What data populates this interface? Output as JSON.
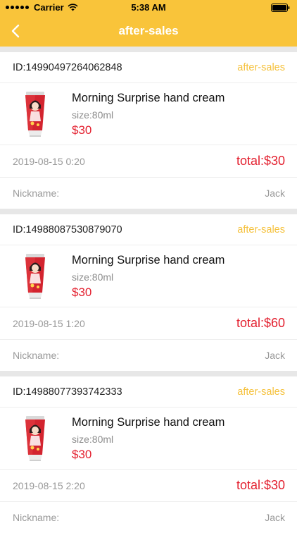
{
  "status_bar": {
    "carrier": "Carrier",
    "time": "5:38 AM"
  },
  "nav": {
    "title": "after-sales",
    "back_icon": "chevron-left-icon"
  },
  "colors": {
    "header": "#f9c43a",
    "status": "#f5c13b",
    "price": "#e3202f"
  },
  "orders": [
    {
      "id": "ID:14990497264062848",
      "status": "after-sales",
      "product": {
        "name": "Morning Surprise hand cream",
        "size": "size:80ml",
        "price": "$30"
      },
      "date": "2019-08-15 0:20",
      "total": "total:$30",
      "nickname_label": "Nickname:",
      "nickname": "Jack"
    },
    {
      "id": "ID:14988087530879070",
      "status": "after-sales",
      "product": {
        "name": "Morning Surprise hand cream",
        "size": "size:80ml",
        "price": "$30"
      },
      "date": "2019-08-15 1:20",
      "total": "total:$60",
      "nickname_label": "Nickname:",
      "nickname": "Jack"
    },
    {
      "id": "ID:14988077393742333",
      "status": "after-sales",
      "product": {
        "name": "Morning Surprise hand cream",
        "size": "size:80ml",
        "price": "$30"
      },
      "date": "2019-08-15 2:20",
      "total": "total:$30",
      "nickname_label": "Nickname:",
      "nickname": "Jack"
    }
  ]
}
